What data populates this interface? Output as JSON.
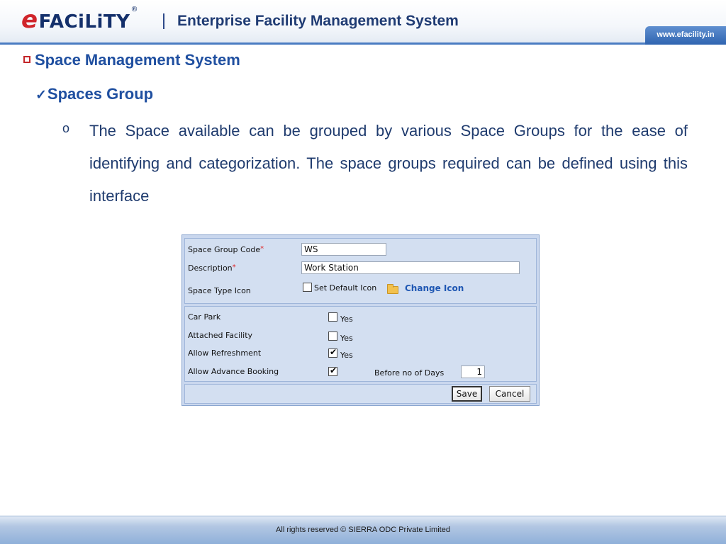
{
  "header": {
    "logo_e": "e",
    "logo_rest": "FACiLiTY",
    "logo_mark": "®",
    "title": "Enterprise Facility Management System",
    "url": "www.efacility.in"
  },
  "content": {
    "heading": "Space Management System",
    "subheading": "Spaces Group",
    "bullet": "o",
    "paragraph": "The Space available can be grouped by various Space Groups for the ease of identifying and categorization. The space groups required can be defined using this interface"
  },
  "form": {
    "space_group_code_label": "Space Group Code",
    "space_group_code_value": "WS",
    "description_label": "Description",
    "description_value": "Work Station",
    "required_mark": "*",
    "space_type_icon_label": "Space Type Icon",
    "set_default_icon_label": "Set Default Icon",
    "set_default_icon_checked": false,
    "change_icon_label": "Change Icon",
    "car_park_label": "Car Park",
    "car_park_option": "Yes",
    "car_park_checked": false,
    "attached_facility_label": "Attached Facility",
    "attached_facility_option": "Yes",
    "attached_facility_checked": false,
    "allow_refreshment_label": "Allow Refreshment",
    "allow_refreshment_option": "Yes",
    "allow_refreshment_checked": true,
    "allow_advance_booking_label": "Allow Advance Booking",
    "allow_advance_booking_checked": true,
    "before_days_label": "Before no of Days",
    "before_days_value": "1",
    "save_label": "Save",
    "cancel_label": "Cancel"
  },
  "footer": {
    "text": "All rights reserved © SIERRA ODC Private Limited"
  },
  "colors": {
    "brand_red": "#d0252b",
    "brand_blue": "#1f4fa0",
    "panel_bg": "#c9d7ee"
  }
}
